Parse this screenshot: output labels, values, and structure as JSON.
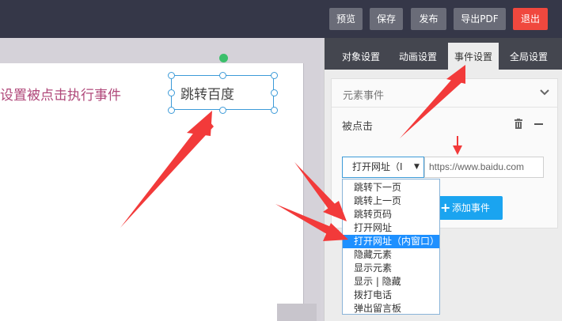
{
  "toolbar": {
    "preview": "预览",
    "save": "保存",
    "publish": "发布",
    "export_pdf": "导出PDF",
    "exit": "退出"
  },
  "canvas": {
    "text": "设置被点击执行事件",
    "selected_element_text": "跳转百度"
  },
  "panel": {
    "tabs": [
      "对象设置",
      "动画设置",
      "事件设置",
      "全局设置"
    ],
    "active_tab": "事件设置",
    "section_title": "元素事件",
    "event_label": "被点击",
    "action_select_value": "打开网址（I",
    "url_input_value": "https://www.baidu.com",
    "add_event_label": "添加事件"
  },
  "dropdown": {
    "options": [
      "跳转下一页",
      "跳转上一页",
      "跳转页码",
      "打开网址",
      "打开网址（内窗口）",
      "隐藏元素",
      "显示元素",
      "显示 | 隐藏",
      "拨打电话",
      "弹出留言板"
    ],
    "highlighted": "打开网址（内窗口）"
  },
  "colors": {
    "topbar": "#353748",
    "exit": "#f0483e",
    "accent": "#1aa4f0",
    "arrow": "#f23a3a",
    "highlight": "#1e90ff"
  }
}
